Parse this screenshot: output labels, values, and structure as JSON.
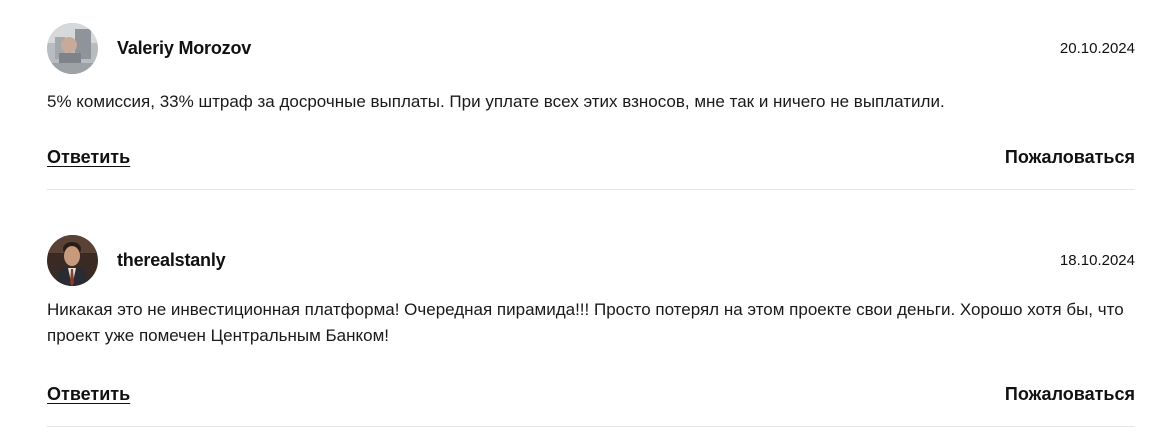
{
  "comments": [
    {
      "author": "Valeriy Morozov",
      "date": "20.10.2024",
      "text": "5% комиссия, 33% штраф за досрочные выплаты. При уплате всех этих взносов, мне так и ничего не выплатили.",
      "reply_label": "Ответить",
      "complain_label": "Пожаловаться"
    },
    {
      "author": "therealstanly",
      "date": "18.10.2024",
      "text": "Никакая это не инвестиционная платформа! Очередная пирамида!!! Просто потерял на этом проекте свои деньги. Хорошо хотя бы, что проект уже помечен Центральным Банком!",
      "reply_label": "Ответить",
      "complain_label": "Пожаловаться"
    }
  ]
}
